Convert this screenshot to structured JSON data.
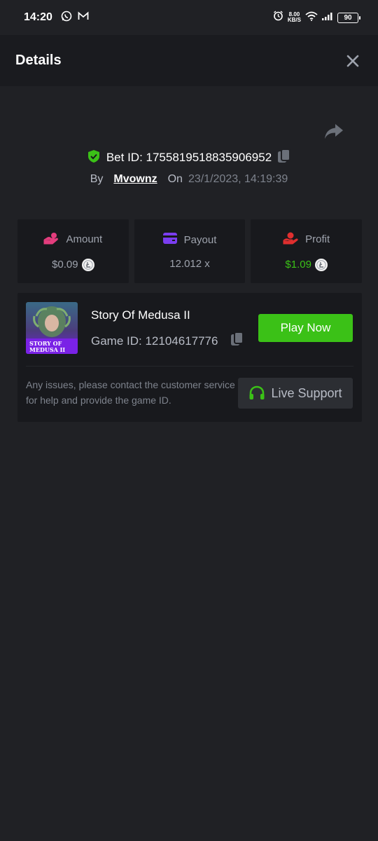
{
  "status_bar": {
    "time": "14:20",
    "net_speed_value": "8.00",
    "net_speed_unit": "KB/S",
    "battery": "90"
  },
  "header": {
    "title": "Details"
  },
  "bet": {
    "id_text": "Bet ID: 1755819518835906952",
    "by_label": "By",
    "user": "Mvownz",
    "on_label": "On",
    "date": "23/1/2023, 14:19:39"
  },
  "stats": [
    {
      "label": "Amount",
      "value": "$0.09",
      "icon": "money-hand-icon"
    },
    {
      "label": "Payout",
      "value": "12.012 x",
      "icon": "card-icon"
    },
    {
      "label": "Profit",
      "value": "$1.09",
      "icon": "profit-hand-icon"
    }
  ],
  "game": {
    "thumb_line1": "STORY OF",
    "thumb_line2": "MEDUSA II",
    "title": "Story Of Medusa II",
    "id_text": "Game ID: 12104617776",
    "play_label": "Play Now",
    "issue_text": "Any issues, please contact the customer service for help and provide the game ID.",
    "support_label": "Live Support"
  },
  "colors": {
    "background": "#202125",
    "card": "#18191d",
    "accent_green": "#3bc117",
    "amount_icon": "#e33d7d",
    "payout_icon": "#7b3df0",
    "profit_icon": "#e02f2f"
  }
}
